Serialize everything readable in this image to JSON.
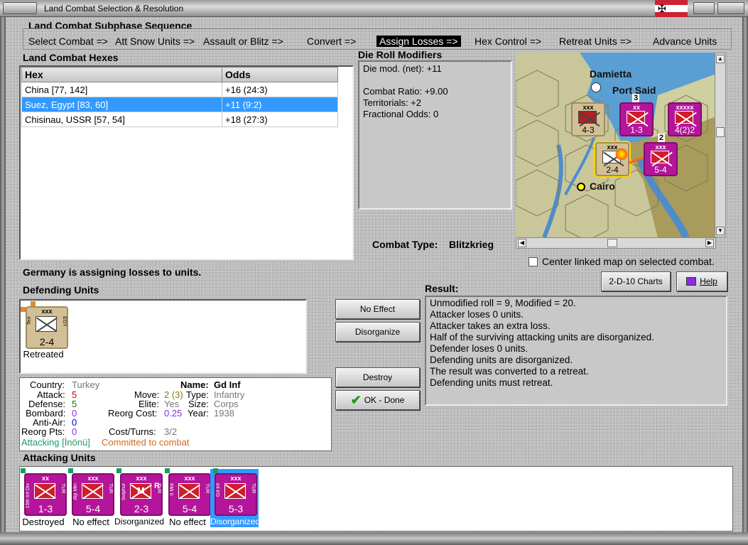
{
  "window": {
    "title": "Land Combat Selection & Resolution"
  },
  "sequence": {
    "heading": "Land Combat Subphase Sequence",
    "steps": [
      "Select Combat =>",
      "Att Snow Units =>",
      "Assault or Blitz =>",
      "Convert =>",
      "Assign Losses =>",
      "Hex Control =>",
      "Retreat Units =>",
      "Advance Units"
    ],
    "active_index": 4
  },
  "hexes": {
    "heading": "Land Combat Hexes",
    "columns": [
      "Hex",
      "Odds"
    ],
    "rows": [
      {
        "hex": "China [77, 142]",
        "odds": "+16 (24:3)"
      },
      {
        "hex": "Suez, Egypt [83, 60]",
        "odds": "+11 (9:2)"
      },
      {
        "hex": "Chisinau, USSR [57, 54]",
        "odds": "+18 (27:3)"
      }
    ],
    "selected_index": 1
  },
  "modifiers": {
    "heading": "Die Roll Modifiers",
    "lines": [
      "Die mod. (net): +11",
      "",
      "Combat Ratio: +9.00",
      "Territorials: +2",
      "Fractional Odds: 0"
    ]
  },
  "combat_type": {
    "label": "Combat Type:",
    "value": "Blitzkrieg"
  },
  "map": {
    "places": [
      "Damietta",
      "Port Said",
      "Cairo"
    ],
    "counters": [
      {
        "top": "xxx",
        "value": "4-3",
        "nation": "RSA"
      },
      {
        "top": "xx",
        "value": "1-3",
        "badge": "3"
      },
      {
        "top": "xxxxx",
        "value": "4(2)2"
      },
      {
        "top": "xxx",
        "value": "2-4"
      },
      {
        "top": "xxx",
        "value": "5-4",
        "badge": "2"
      }
    ],
    "center_linked_label": "Center linked map on selected combat."
  },
  "status_message": "Germany is assigning losses to units.",
  "buttons": {
    "charts": "2-D-10 Charts",
    "help": "Help",
    "no_effect": "No Effect",
    "disorganize": "Disorganize",
    "destroy": "Destroy",
    "ok_done": "OK - Done"
  },
  "defending": {
    "heading": "Defending Units",
    "units": [
      {
        "size": "xxx",
        "type": "Terr",
        "nation": "EGY",
        "value": "2-4",
        "status": "Retreated"
      }
    ]
  },
  "unit_info": {
    "country_label": "Country:",
    "country": "Turkey",
    "attack_label": "Attack:",
    "attack": "5",
    "defense_label": "Defense:",
    "defense": "5",
    "bombard_label": "Bombard:",
    "bombard": "0",
    "antiair_label": "Anti-Air:",
    "antiair": "0",
    "reorg_label": "Reorg Pts:",
    "reorg": "0",
    "name_label": "Name:",
    "name": "Gd Inf",
    "move_label": "Move:",
    "move": "2 (3)",
    "type_label": "Type:",
    "type": "Infantry",
    "elite_label": "Elite:",
    "elite": "Yes",
    "size_label": "Size:",
    "size": "Corps",
    "reorgcost_label": "Reorg Cost:",
    "reorgcost": "0.25",
    "year_label": "Year:",
    "year": "1938",
    "costturns_label": "Cost/Turns:",
    "costturns": "3/2",
    "attacking_note": "Attacking [İnönü]",
    "committed_note": "Committed to combat"
  },
  "result": {
    "heading": "Result:",
    "lines": [
      "Unmodified roll = 9, Modified = 20.",
      "Attacker loses 0 units.",
      "Attacker takes an extra loss.",
      "Half of the surviving attacking units are disorganized.",
      "Defender loses 0 units.",
      "Defending units are disorganized.",
      "The result was converted to a retreat.",
      "Defending units must retreat."
    ]
  },
  "attacking": {
    "heading": "Attacking Units",
    "units": [
      {
        "size": "xx",
        "type": "15th Inf Div",
        "nation": "TUR",
        "value": "1-3",
        "status": "Destroyed"
      },
      {
        "size": "xxx",
        "type": "Alp Mtn",
        "nation": "TUR",
        "value": "5-4",
        "status": "No effect"
      },
      {
        "size": "xxx",
        "type": "Sulphur",
        "nation": "TUR",
        "value": "2-3",
        "mark": "M",
        "suffix": "R",
        "status": "Disorganized"
      },
      {
        "size": "xxx",
        "type": "II Mot",
        "nation": "TUR",
        "value": "5-4",
        "status": "No effect"
      },
      {
        "size": "xxx",
        "type": "Gd Inf",
        "nation": "TUR",
        "value": "5-3",
        "status": "Disorganized"
      }
    ],
    "selected_index": 4
  },
  "colors": {
    "selection": "#3399ff",
    "unit_magenta": "#b5159b",
    "unit_tan": "#d2bf95",
    "attack_red": "#cc0000",
    "defense_green": "#008000",
    "purple": "#8a2be2"
  }
}
